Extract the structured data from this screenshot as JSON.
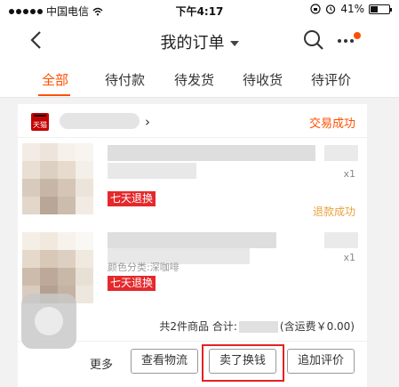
{
  "status_bar": {
    "carrier": "中国电信",
    "time": "下午4:17",
    "battery": "41%",
    "battery_level": 0.41
  },
  "nav": {
    "title": "我的订单"
  },
  "tabs": [
    {
      "label": "全部",
      "active": true
    },
    {
      "label": "待付款"
    },
    {
      "label": "待发货"
    },
    {
      "label": "待收货"
    },
    {
      "label": "待评价"
    }
  ],
  "order": {
    "shop_logo_text": "天猫",
    "status": "交易成功",
    "items": [
      {
        "qty": "x1",
        "tag": "七天退换",
        "refund_status": "退款成功"
      },
      {
        "qty": "x1",
        "sku": "颜色分类:深咖啡",
        "tag": "七天退换"
      }
    ],
    "summary": {
      "count_text": "共2件商品 合计:",
      "shipping_text": "(含运费￥0.00)"
    },
    "actions": {
      "more": "更多",
      "logistics": "查看物流",
      "sell": "卖了换钱",
      "add_review": "追加评价"
    }
  },
  "colors": {
    "accent": "#ff5000",
    "tag_red": "#e4292c",
    "refund": "#e8a23a",
    "highlight": "#e52125"
  }
}
